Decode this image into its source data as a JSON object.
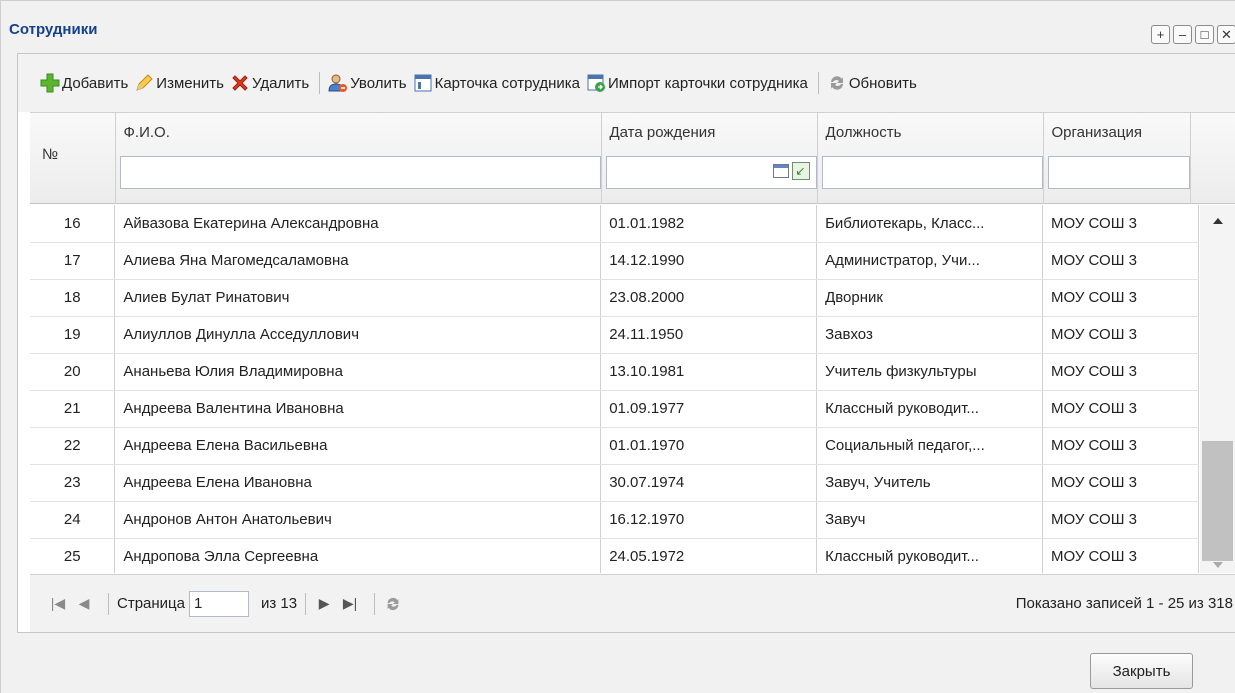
{
  "window": {
    "title": "Сотрудники",
    "buttons": [
      {
        "name": "add-window-button",
        "glyph": "+"
      },
      {
        "name": "minimize-button",
        "glyph": "–"
      },
      {
        "name": "maximize-button",
        "glyph": "□"
      },
      {
        "name": "close-window-button",
        "glyph": "✕"
      }
    ]
  },
  "toolbar": {
    "add": "Добавить",
    "edit": "Изменить",
    "delete": "Удалить",
    "dismiss": "Уволить",
    "card": "Карточка сотрудника",
    "import": "Импорт карточки сотрудника",
    "refresh": "Обновить"
  },
  "grid": {
    "columns": {
      "num": "№",
      "name": "Ф.И.О.",
      "birth": "Дата рождения",
      "position": "Должность",
      "org": "Организация"
    },
    "rows": [
      {
        "n": "16",
        "name": "Айвазова Екатерина Александровна",
        "birth": "01.01.1982",
        "position": "Библиотекарь, Класс...",
        "org": "МОУ СОШ 3"
      },
      {
        "n": "17",
        "name": "Алиева Яна Магомедсаламовна",
        "birth": "14.12.1990",
        "position": "Администратор, Учи...",
        "org": "МОУ СОШ 3"
      },
      {
        "n": "18",
        "name": "Алиев Булат Ринатович",
        "birth": "23.08.2000",
        "position": "Дворник",
        "org": "МОУ СОШ 3"
      },
      {
        "n": "19",
        "name": "Алиуллов Динулла Асседуллович",
        "birth": "24.11.1950",
        "position": "Завхоз",
        "org": "МОУ СОШ 3"
      },
      {
        "n": "20",
        "name": "Ананьева Юлия Владимировна",
        "birth": "13.10.1981",
        "position": "Учитель физкультуры",
        "org": "МОУ СОШ 3"
      },
      {
        "n": "21",
        "name": "Андреева Валентина Ивановна",
        "birth": "01.09.1977",
        "position": "Классный руководит...",
        "org": "МОУ СОШ 3"
      },
      {
        "n": "22",
        "name": "Андреева Елена Васильевна",
        "birth": "01.01.1970",
        "position": "Социальный педагог,...",
        "org": "МОУ СОШ 3"
      },
      {
        "n": "23",
        "name": "Андреева Елена Ивановна",
        "birth": "30.07.1974",
        "position": "Завуч, Учитель",
        "org": "МОУ СОШ 3"
      },
      {
        "n": "24",
        "name": "Андронов Антон Анатольевич",
        "birth": "16.12.1970",
        "position": "Завуч",
        "org": "МОУ СОШ 3"
      },
      {
        "n": "25",
        "name": "Андропова Элла Сергеевна",
        "birth": "24.05.1972",
        "position": "Классный руководит...",
        "org": "МОУ СОШ 3"
      }
    ]
  },
  "pager": {
    "page_label": "Страница",
    "page_value": "1",
    "of_label": "из 13",
    "info": "Показано записей 1 - 25 из 318"
  },
  "footer": {
    "close_label": "Закрыть"
  }
}
